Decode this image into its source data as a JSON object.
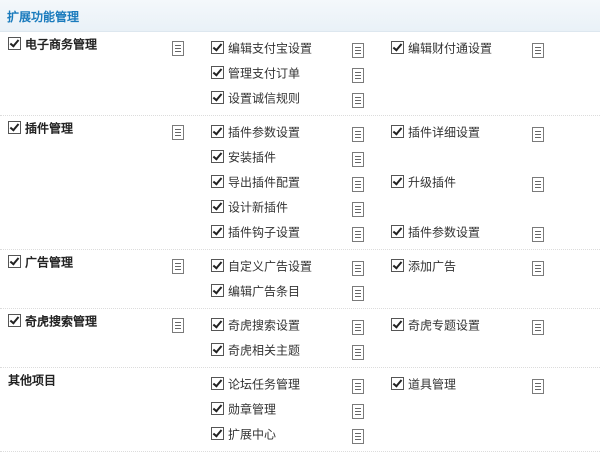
{
  "header": {
    "title": "扩展功能管理"
  },
  "groups": [
    {
      "name": "电子商务管理",
      "checkbox": true,
      "items": [
        {
          "label": "编辑支付宝设置",
          "checked": true
        },
        {
          "label": "编辑财付通设置",
          "checked": true
        },
        {
          "label": "管理支付订单",
          "checked": true
        },
        {
          "label": "设置诚信规则",
          "checked": true
        }
      ]
    },
    {
      "name": "插件管理",
      "checkbox": true,
      "items": [
        {
          "label": "插件参数设置",
          "checked": true
        },
        {
          "label": "插件详细设置",
          "checked": true
        },
        {
          "label": "安装插件",
          "checked": true
        },
        {
          "label": "导出插件配置",
          "checked": true
        },
        {
          "label": "升级插件",
          "checked": true
        },
        {
          "label": "设计新插件",
          "checked": true
        },
        {
          "label": "插件钩子设置",
          "checked": true
        },
        {
          "label": "插件参数设置",
          "checked": true
        }
      ]
    },
    {
      "name": "广告管理",
      "checkbox": true,
      "items": [
        {
          "label": "自定义广告设置",
          "checked": true
        },
        {
          "label": "添加广告",
          "checked": true
        },
        {
          "label": "编辑广告条目",
          "checked": true
        }
      ]
    },
    {
      "name": "奇虎搜索管理",
      "checkbox": true,
      "items": [
        {
          "label": "奇虎搜索设置",
          "checked": true
        },
        {
          "label": "奇虎专题设置",
          "checked": true
        },
        {
          "label": "奇虎相关主题",
          "checked": true
        }
      ]
    },
    {
      "name": "其他项目",
      "checkbox": false,
      "items": [
        {
          "label": "论坛任务管理",
          "checked": true
        },
        {
          "label": "道具管理",
          "checked": true
        },
        {
          "label": "勋章管理",
          "checked": true
        },
        {
          "label": "扩展中心",
          "checked": true
        }
      ]
    }
  ],
  "icons": {
    "checkbox": "checkbox-checked-icon",
    "doc": "document-list-icon"
  }
}
